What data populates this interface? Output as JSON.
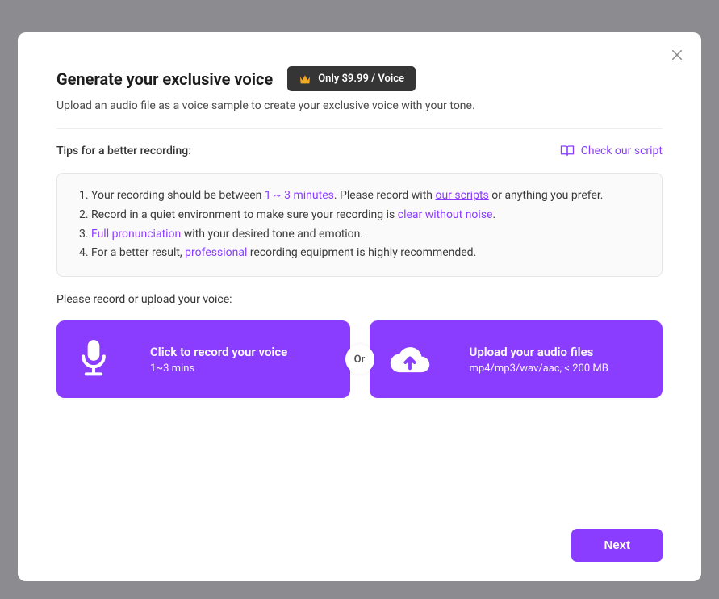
{
  "header": {
    "title": "Generate your exclusive voice",
    "price_label": "Only $9.99 / Voice"
  },
  "subtitle": "Upload an audio file as a voice sample to create your exclusive voice with your tone.",
  "tips": {
    "label": "Tips for a better recording:",
    "check_script": "Check our script",
    "item1": {
      "a": "Your recording should be between ",
      "b": "1 ~ 3 minutes",
      "c": ". Please record with ",
      "d": "our scripts",
      "e": " or anything you prefer."
    },
    "item2": {
      "a": "Record in a quiet environment to make sure your recording is ",
      "b": "clear without noise",
      "c": "."
    },
    "item3": {
      "a": "Full pronunciation",
      "b": " with your desired tone and emotion."
    },
    "item4": {
      "a": "For a better result, ",
      "b": "professional",
      "c": " recording equipment is highly recommended."
    }
  },
  "actions": {
    "label": "Please record or upload your voice:",
    "record_title": "Click to record your voice",
    "record_sub": "1~3 mins",
    "upload_title": "Upload your audio files",
    "upload_sub": "mp4/mp3/wav/aac, < 200 MB",
    "or": "Or"
  },
  "footer": {
    "next": "Next"
  }
}
